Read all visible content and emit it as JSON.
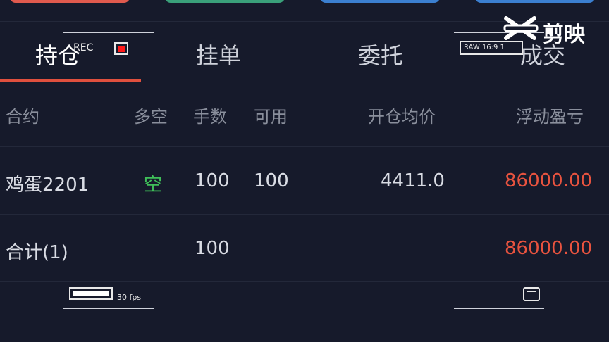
{
  "tabs": [
    {
      "label": "持仓",
      "active": true
    },
    {
      "label": "挂单",
      "active": false
    },
    {
      "label": "委托",
      "active": false
    },
    {
      "label": "成交",
      "active": false
    }
  ],
  "table": {
    "headers": [
      "合约",
      "多空",
      "手数",
      "可用",
      "开仓均价",
      "浮动盈亏"
    ],
    "rows": [
      {
        "contract": "鸡蛋2201",
        "direction": "空",
        "lots": "100",
        "available": "100",
        "avg_price": "4411.0",
        "pnl": "86000.00"
      }
    ],
    "total": {
      "label": "合计(1)",
      "lots": "100",
      "pnl": "86000.00"
    }
  },
  "overlay": {
    "rec_label": "REC",
    "raw_label": "RAW 16:9 1",
    "fps_label": "30 fps"
  },
  "watermark": {
    "text": "剪映",
    "icon": "capcut-logo-icon"
  },
  "colors": {
    "background": "#161a2b",
    "accent": "#e0503e",
    "short": "#3fbf59",
    "profit": "#e8533f"
  }
}
